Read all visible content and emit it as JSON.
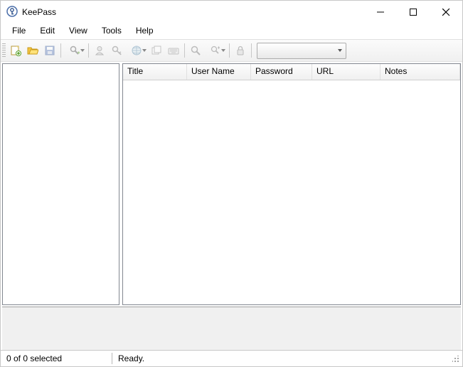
{
  "titlebar": {
    "title": "KeePass"
  },
  "menu": {
    "file": "File",
    "edit": "Edit",
    "view": "View",
    "tools": "Tools",
    "help": "Help"
  },
  "toolbar": {
    "dropdown_value": ""
  },
  "columns": {
    "title": "Title",
    "user_name": "User Name",
    "password": "Password",
    "url": "URL",
    "notes": "Notes"
  },
  "status": {
    "selection": "0 of 0 selected",
    "ready": "Ready."
  }
}
